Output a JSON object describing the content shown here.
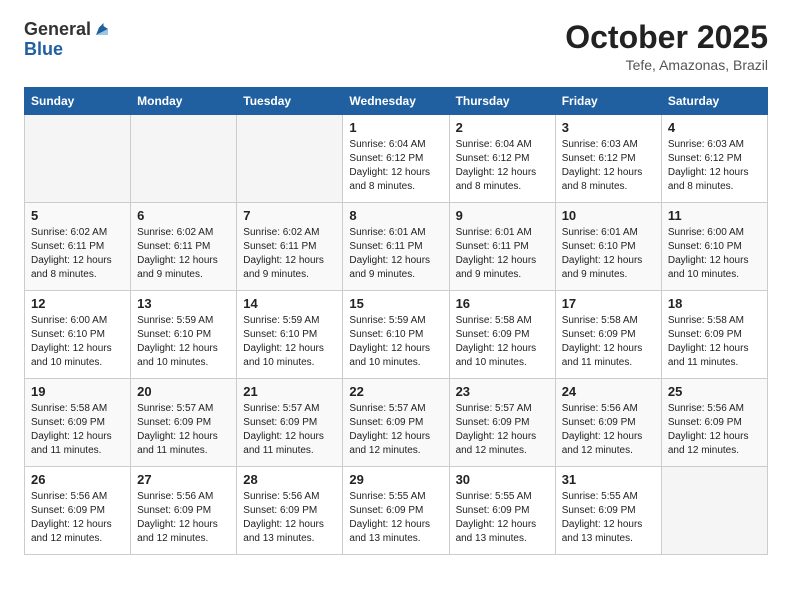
{
  "header": {
    "logo_general": "General",
    "logo_blue": "Blue",
    "title": "October 2025",
    "subtitle": "Tefe, Amazonas, Brazil"
  },
  "weekdays": [
    "Sunday",
    "Monday",
    "Tuesday",
    "Wednesday",
    "Thursday",
    "Friday",
    "Saturday"
  ],
  "weeks": [
    [
      {
        "day": "",
        "info": ""
      },
      {
        "day": "",
        "info": ""
      },
      {
        "day": "",
        "info": ""
      },
      {
        "day": "1",
        "info": "Sunrise: 6:04 AM\nSunset: 6:12 PM\nDaylight: 12 hours\nand 8 minutes."
      },
      {
        "day": "2",
        "info": "Sunrise: 6:04 AM\nSunset: 6:12 PM\nDaylight: 12 hours\nand 8 minutes."
      },
      {
        "day": "3",
        "info": "Sunrise: 6:03 AM\nSunset: 6:12 PM\nDaylight: 12 hours\nand 8 minutes."
      },
      {
        "day": "4",
        "info": "Sunrise: 6:03 AM\nSunset: 6:12 PM\nDaylight: 12 hours\nand 8 minutes."
      }
    ],
    [
      {
        "day": "5",
        "info": "Sunrise: 6:02 AM\nSunset: 6:11 PM\nDaylight: 12 hours\nand 8 minutes."
      },
      {
        "day": "6",
        "info": "Sunrise: 6:02 AM\nSunset: 6:11 PM\nDaylight: 12 hours\nand 9 minutes."
      },
      {
        "day": "7",
        "info": "Sunrise: 6:02 AM\nSunset: 6:11 PM\nDaylight: 12 hours\nand 9 minutes."
      },
      {
        "day": "8",
        "info": "Sunrise: 6:01 AM\nSunset: 6:11 PM\nDaylight: 12 hours\nand 9 minutes."
      },
      {
        "day": "9",
        "info": "Sunrise: 6:01 AM\nSunset: 6:11 PM\nDaylight: 12 hours\nand 9 minutes."
      },
      {
        "day": "10",
        "info": "Sunrise: 6:01 AM\nSunset: 6:10 PM\nDaylight: 12 hours\nand 9 minutes."
      },
      {
        "day": "11",
        "info": "Sunrise: 6:00 AM\nSunset: 6:10 PM\nDaylight: 12 hours\nand 10 minutes."
      }
    ],
    [
      {
        "day": "12",
        "info": "Sunrise: 6:00 AM\nSunset: 6:10 PM\nDaylight: 12 hours\nand 10 minutes."
      },
      {
        "day": "13",
        "info": "Sunrise: 5:59 AM\nSunset: 6:10 PM\nDaylight: 12 hours\nand 10 minutes."
      },
      {
        "day": "14",
        "info": "Sunrise: 5:59 AM\nSunset: 6:10 PM\nDaylight: 12 hours\nand 10 minutes."
      },
      {
        "day": "15",
        "info": "Sunrise: 5:59 AM\nSunset: 6:10 PM\nDaylight: 12 hours\nand 10 minutes."
      },
      {
        "day": "16",
        "info": "Sunrise: 5:58 AM\nSunset: 6:09 PM\nDaylight: 12 hours\nand 10 minutes."
      },
      {
        "day": "17",
        "info": "Sunrise: 5:58 AM\nSunset: 6:09 PM\nDaylight: 12 hours\nand 11 minutes."
      },
      {
        "day": "18",
        "info": "Sunrise: 5:58 AM\nSunset: 6:09 PM\nDaylight: 12 hours\nand 11 minutes."
      }
    ],
    [
      {
        "day": "19",
        "info": "Sunrise: 5:58 AM\nSunset: 6:09 PM\nDaylight: 12 hours\nand 11 minutes."
      },
      {
        "day": "20",
        "info": "Sunrise: 5:57 AM\nSunset: 6:09 PM\nDaylight: 12 hours\nand 11 minutes."
      },
      {
        "day": "21",
        "info": "Sunrise: 5:57 AM\nSunset: 6:09 PM\nDaylight: 12 hours\nand 11 minutes."
      },
      {
        "day": "22",
        "info": "Sunrise: 5:57 AM\nSunset: 6:09 PM\nDaylight: 12 hours\nand 12 minutes."
      },
      {
        "day": "23",
        "info": "Sunrise: 5:57 AM\nSunset: 6:09 PM\nDaylight: 12 hours\nand 12 minutes."
      },
      {
        "day": "24",
        "info": "Sunrise: 5:56 AM\nSunset: 6:09 PM\nDaylight: 12 hours\nand 12 minutes."
      },
      {
        "day": "25",
        "info": "Sunrise: 5:56 AM\nSunset: 6:09 PM\nDaylight: 12 hours\nand 12 minutes."
      }
    ],
    [
      {
        "day": "26",
        "info": "Sunrise: 5:56 AM\nSunset: 6:09 PM\nDaylight: 12 hours\nand 12 minutes."
      },
      {
        "day": "27",
        "info": "Sunrise: 5:56 AM\nSunset: 6:09 PM\nDaylight: 12 hours\nand 12 minutes."
      },
      {
        "day": "28",
        "info": "Sunrise: 5:56 AM\nSunset: 6:09 PM\nDaylight: 12 hours\nand 13 minutes."
      },
      {
        "day": "29",
        "info": "Sunrise: 5:55 AM\nSunset: 6:09 PM\nDaylight: 12 hours\nand 13 minutes."
      },
      {
        "day": "30",
        "info": "Sunrise: 5:55 AM\nSunset: 6:09 PM\nDaylight: 12 hours\nand 13 minutes."
      },
      {
        "day": "31",
        "info": "Sunrise: 5:55 AM\nSunset: 6:09 PM\nDaylight: 12 hours\nand 13 minutes."
      },
      {
        "day": "",
        "info": ""
      }
    ]
  ]
}
